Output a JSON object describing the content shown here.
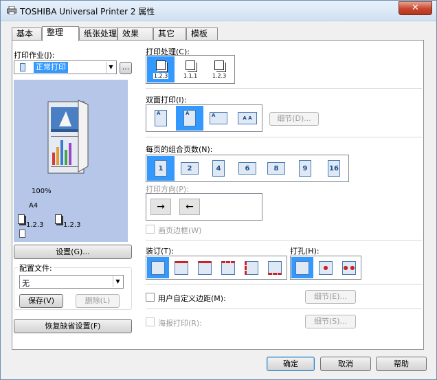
{
  "window": {
    "title": "TOSHIBA Universal Printer 2 属性",
    "close_label": "✕"
  },
  "tabs": [
    "基本",
    "整理",
    "纸张处理",
    "效果",
    "其它",
    "模板"
  ],
  "active_tab": "整理",
  "left": {
    "print_job_label": "打印作业(J):",
    "print_job_value": "正常打印",
    "print_job_more": "...",
    "preview": {
      "zoom": "100%",
      "paper": "A4",
      "copies_a": "1.2.3",
      "copies_b": "1.2.3"
    },
    "settings_button": "设置(G)...",
    "profile_label": "配置文件:",
    "profile_value": "无",
    "save_button": "保存(V)",
    "delete_button": "删除(L)",
    "restore_button": "恢复缺省设置(F)"
  },
  "right": {
    "sort_label": "打印处理(C):",
    "sort_options": [
      "1.2.3",
      "1.1.1",
      "1.2.3"
    ],
    "duplex_label": "双面打印(I):",
    "duplex_details": "细节(D)...",
    "nup_label": "每页的组合页数(N):",
    "nup_options": [
      "1",
      "2",
      "4",
      "6",
      "8",
      "9",
      "16"
    ],
    "orientation_label": "打印方向(P):",
    "page_border_label": "画页边框(W)",
    "staple_label": "装订(T):",
    "punch_label": "打孔(H):",
    "custom_margin_label": "用户自定义边距(M):",
    "custom_margin_details": "细节(E)...",
    "poster_label": "海报打印(R):",
    "poster_details": "细节(S)..."
  },
  "footer": {
    "ok": "确定",
    "cancel": "取消",
    "help": "帮助"
  },
  "colors": {
    "selected": "#3399ff",
    "preview_bg": "#b6c6e8",
    "close": "#c7462e"
  }
}
